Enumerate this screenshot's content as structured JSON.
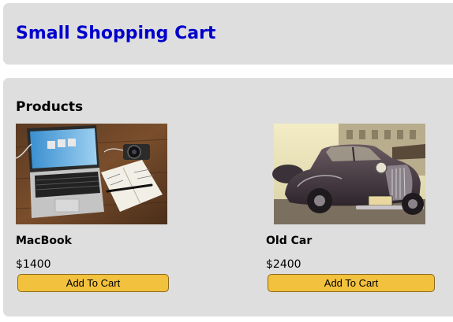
{
  "header": {
    "title": "Small Shopping Cart"
  },
  "products_section": {
    "title": "Products"
  },
  "products": [
    {
      "name": "MacBook",
      "price": "$1400",
      "button_label": "Add To Cart",
      "image": "laptop-photo"
    },
    {
      "name": "Old Car",
      "price": "$2400",
      "button_label": "Add To Cart",
      "image": "vintage-car-photo"
    }
  ],
  "colors": {
    "title": "#0000cd",
    "panel": "#dedede",
    "button": "#f2c13d"
  }
}
